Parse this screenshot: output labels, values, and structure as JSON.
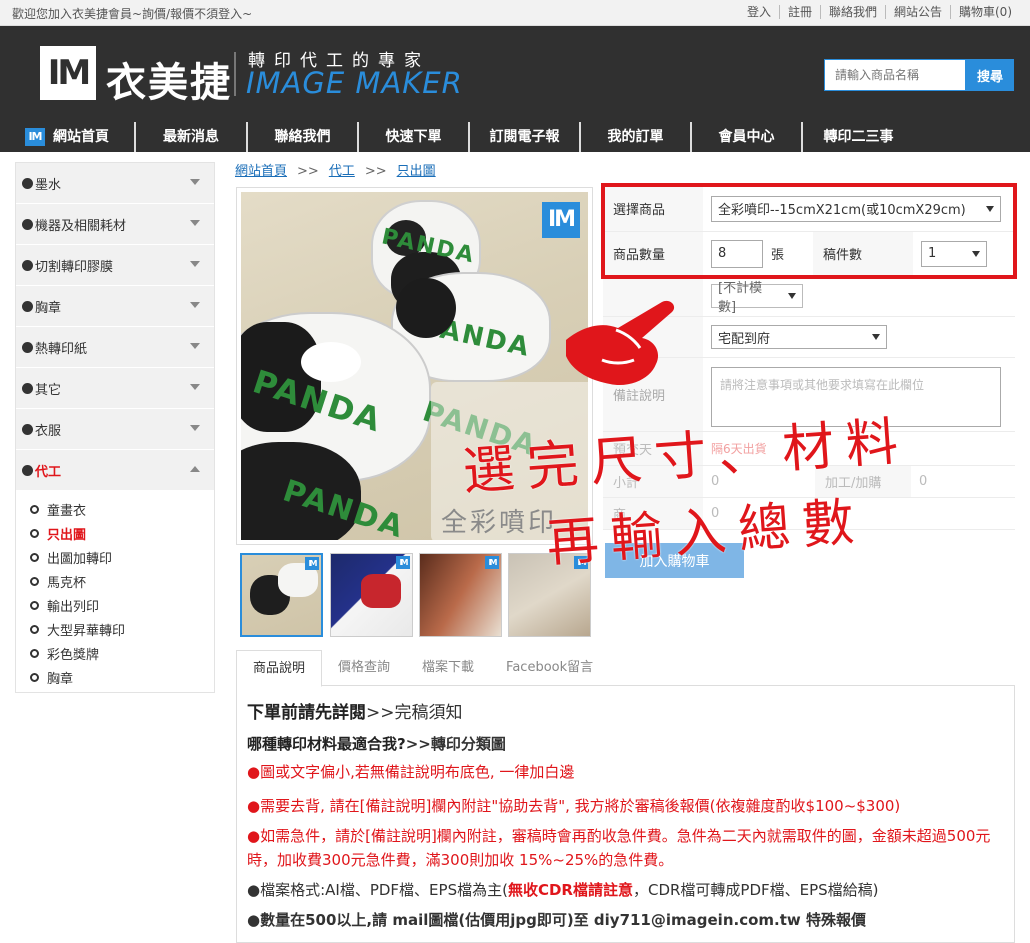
{
  "topbar": {
    "welcome": "歡迎您加入衣美捷會員~詢價/報價不須登入~",
    "links": [
      "登入",
      "註冊",
      "聯絡我們",
      "網站公告",
      "購物車(0)"
    ]
  },
  "header": {
    "logo_text": "IM",
    "brand_name": "衣美捷",
    "tagline": "轉印代工的專家",
    "brand_en": "IMAGE MAKER",
    "search_placeholder": "請輸入商品名稱",
    "search_button": "搜尋"
  },
  "nav": {
    "home_icon": "IM",
    "items": [
      "網站首頁",
      "最新消息",
      "聯絡我們",
      "快速下單",
      "訂閱電子報",
      "我的訂單",
      "會員中心",
      "轉印二三事"
    ]
  },
  "sidebar": {
    "categories": [
      {
        "label": "墨水"
      },
      {
        "label": "機器及相關耗材"
      },
      {
        "label": "切割轉印膠膜"
      },
      {
        "label": "胸章"
      },
      {
        "label": "熱轉印紙"
      },
      {
        "label": "其它"
      },
      {
        "label": "衣服"
      },
      {
        "label": "代工"
      }
    ],
    "subitems": [
      {
        "label": "童畫衣"
      },
      {
        "label": "只出圖"
      },
      {
        "label": "出圖加轉印"
      },
      {
        "label": "馬克杯"
      },
      {
        "label": "輸出列印"
      },
      {
        "label": "大型昇華轉印"
      },
      {
        "label": "彩色獎牌"
      },
      {
        "label": "胸章"
      }
    ]
  },
  "breadcrumb": {
    "items": [
      "網站首頁",
      "代工",
      "只出圖"
    ],
    "separator": ">>"
  },
  "product": {
    "image_caption": "全彩噴印",
    "panda_label": "PANDA",
    "badge": "IM"
  },
  "form": {
    "product_label": "選擇商品",
    "product_value": "全彩噴印--15cmX21cm(或10cmX29cm)",
    "qty_label": "商品數量",
    "qty_value": "8",
    "qty_unit": "張",
    "count_label": "稿件數",
    "count_value": "1",
    "mode_value": "[不計模數]",
    "ship_value": "宅配到府",
    "notes_label": "備註說明",
    "notes_placeholder": "請將注意事項或其他要求填寫在此欄位",
    "rush_label": "預交天",
    "rush_hint": "隔6天出貨",
    "subtotal_label": "小計",
    "subtotal_value": "0",
    "extra_label": "加工/加購",
    "extra_value": "0",
    "total_label": "商",
    "total_value": "0",
    "cart_button": "加入購物車"
  },
  "annotation": {
    "line1": "選完尺寸、材料",
    "line2": "再輸入總數"
  },
  "tabs": [
    "商品說明",
    "價格查詢",
    "檔案下載",
    "Facebook留言"
  ],
  "content": {
    "heading_a": "下單前請先詳閱",
    "heading_b": ">>完稿須知",
    "subheading_a": "哪種轉印材料最適合我?",
    "subheading_b": ">>轉印分類圖",
    "p1": "●圖或文字偏小,若無備註說明布底色, 一律加白邊",
    "p2": "●需要去背, 請在[備註說明]欄內附註\"協助去背\", 我方將於審稿後報價(依複雜度酌收$100~$300)",
    "p3": "●如需急件，請於[備註說明]欄內附註，審稿時會再酌收急件費。急件為二天內就需取件的圖，金額未超過500元時，加收費300元急件費，滿300則加收  15%~25%的急件費。",
    "p4_a": "●檔案格式:AI檔、PDF檔、EPS檔為主(",
    "p4_b": "無收CDR檔請註意",
    "p4_c": "，CDR檔可轉成PDF檔、EPS檔給稿)",
    "p5": "●數量在500以上,請 mail圖檔(估價用jpg即可)至 diy711@imagein.com.tw 特殊報價"
  }
}
